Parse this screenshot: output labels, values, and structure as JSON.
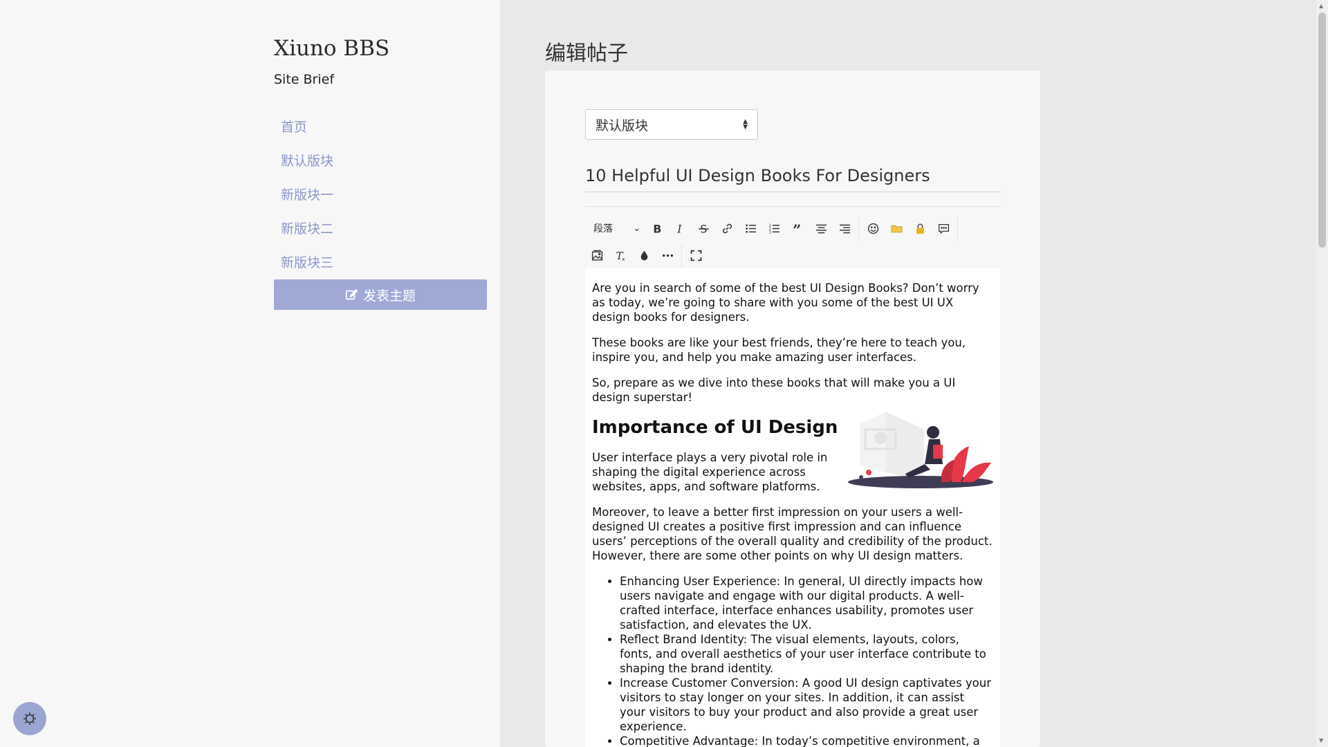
{
  "site": {
    "name": "Xiuno BBS",
    "brief": "Site Brief"
  },
  "nav": {
    "items": [
      {
        "label": "首页"
      },
      {
        "label": "默认版块"
      },
      {
        "label": "新版块一"
      },
      {
        "label": "新版块二"
      },
      {
        "label": "新版块三"
      }
    ],
    "new_topic_label": "发表主题"
  },
  "page": {
    "title": "编辑帖子"
  },
  "form": {
    "forum_select": "默认版块",
    "title_value": "10 Helpful UI Design Books For Designers"
  },
  "toolbar": {
    "paragraph_select": "段落",
    "row1_icons": [
      "bold-icon",
      "italic-icon",
      "strikethrough-icon",
      "link-icon",
      "bullet-list-icon",
      "numbered-list-icon",
      "blockquote-icon",
      "align-center-icon",
      "align-right-icon",
      "emoji-icon",
      "folder-icon",
      "lock-icon",
      "comment-icon"
    ],
    "row2_icons": [
      "image-icon",
      "clear-format-icon",
      "color-drop-icon",
      "more-icon",
      "fullscreen-icon"
    ]
  },
  "content": {
    "p1": "Are you in search of some of the best UI Design Books? Don’t worry as today, we’re going to share with you some of the best UI UX design books for designers.",
    "p2": "These books are like your best friends, they’re here to teach you, inspire you, and help you make amazing user interfaces.",
    "p3": "So, prepare as we dive into these books that will make you a UI design superstar!",
    "h2": "Importance of UI Design",
    "p4": "User interface plays a very pivotal role in shaping the digital experience across websites, apps, and software platforms.",
    "p5": "Moreover, to leave a better first impression on your users a well-designed UI creates a positive first impression and can influence users’ perceptions of the overall quality and credibility of the product. However, there are some other points on why UI design matters.",
    "list": [
      "Enhancing User Experience: In general, UI directly impacts how users navigate and engage with our digital products. A well-crafted interface, interface enhances usability, promotes user satisfaction, and elevates the UX.",
      "Reflect Brand Identity: The visual elements, layouts, colors, fonts, and overall aesthetics of your user interface contribute to shaping the brand identity.",
      "Increase Customer Conversion: A good UI design captivates your visitors to stay longer on your sites. In addition, it can assist your visitors to buy your product and also provide a great user experience.",
      "Competitive Advantage: In today’s competitive environment, a superior UI distinguishes products, attracting and keeping users."
    ]
  },
  "colors": {
    "accent": "#a0a9d5",
    "nav_link": "#8b96c8",
    "sidebar_bg": "#f7f7f7",
    "main_bg": "#e9e9e9"
  }
}
